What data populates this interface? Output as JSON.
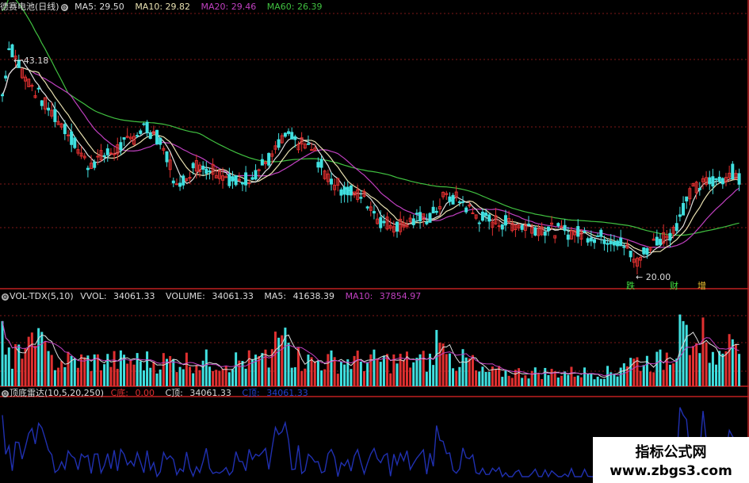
{
  "main_panel": {
    "title": "德赛电池(日线)",
    "indicators": [
      {
        "name": "MA5",
        "value": "29.50",
        "color": "#dddddd"
      },
      {
        "name": "MA10",
        "value": "29.82",
        "color": "#e8e0b0"
      },
      {
        "name": "MA20",
        "value": "29.46",
        "color": "#c040c0"
      },
      {
        "name": "MA60",
        "value": "26.39",
        "color": "#40c040"
      }
    ],
    "high_label": "43.18",
    "low_label": "20.00",
    "markers": [
      "跌",
      "财",
      "增"
    ]
  },
  "volume_panel": {
    "title": "VOL-TDX(5,10)",
    "vvol_label": "VVOL:",
    "vvol_value": "34061.33",
    "volume_label": "VOLUME:",
    "volume_value": "34061.33",
    "ma5_label": "MA5:",
    "ma5_value": "41638.39",
    "ma10_label": "MA10:",
    "ma10_value": "37854.97"
  },
  "radar_panel": {
    "title": "顶底雷达(10,5,20,250)",
    "c_bottom_label": "C底:",
    "c_bottom_value": "0.00",
    "c_top_label": "C顶:",
    "c_top_value": "34061.33",
    "extra_label": "C顶:",
    "extra_value": "34061.33"
  },
  "watermark": {
    "line1": "指标公式网",
    "line2": "www.zbgs3.com"
  },
  "colors": {
    "up": "#e03030",
    "down": "#40e0e0",
    "ma5": "#dddddd",
    "ma10": "#e8e0b0",
    "ma20": "#c040c0",
    "ma60": "#40c040",
    "grid": "#801818",
    "radar": "#2030b0"
  },
  "chart_data": {
    "type": "line",
    "price_key_points_x": [
      0,
      12,
      30,
      60,
      85,
      110,
      140,
      165,
      180,
      195,
      210,
      220,
      225,
      235,
      250,
      270,
      300,
      320,
      345,
      360,
      375,
      395,
      410,
      430,
      460,
      480,
      500,
      520,
      545,
      560,
      580,
      600,
      620,
      640,
      660,
      700,
      730,
      760,
      780,
      795,
      805,
      815,
      830,
      850,
      870,
      890,
      910,
      925,
      935
    ],
    "price_key_points_y": [
      36.0,
      43.18,
      40.0,
      36.5,
      34.0,
      30.5,
      31.8,
      33.0,
      34.5,
      33.8,
      31.5,
      29.0,
      27.5,
      29.5,
      30.5,
      30.0,
      28.5,
      29.5,
      31.5,
      33.5,
      32.8,
      32.0,
      29.5,
      28.0,
      27.0,
      24.5,
      24.0,
      24.5,
      25.0,
      27.0,
      26.8,
      25.0,
      24.5,
      24.3,
      24.0,
      23.5,
      23.2,
      22.8,
      22.5,
      21.0,
      20.0,
      21.5,
      22.5,
      23.5,
      27.5,
      28.5,
      29.0,
      29.8,
      28.5
    ],
    "ylim": [
      17.5,
      46.5
    ],
    "high": 43.18,
    "low": 20.0,
    "volume_ylim": [
      0,
      100000
    ]
  }
}
